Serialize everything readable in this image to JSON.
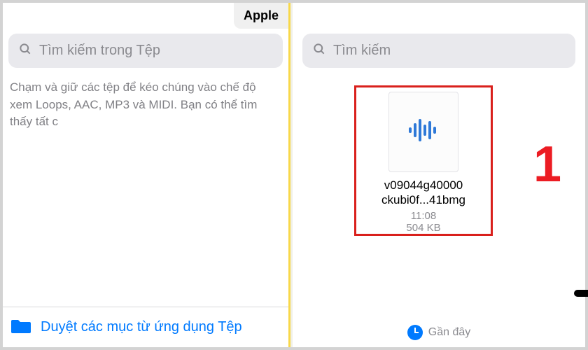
{
  "left": {
    "tab_label": "Apple",
    "search_placeholder": "Tìm kiếm trong Tệp",
    "hint": "Chạm và giữ các tệp để kéo chúng vào chế độ xem Loops, AAC, MP3 và MIDI. Bạn có thể tìm thấy tất c",
    "browse_label": "Duyệt các mục từ ứng dụng Tệp"
  },
  "right": {
    "search_placeholder": "Tìm kiếm",
    "file": {
      "name_line1": "v09044g40000",
      "name_line2": "ckubi0f...41bmg",
      "time": "11:08",
      "size": "504 KB"
    },
    "annotation": "1",
    "recent_label": "Gần đây"
  }
}
